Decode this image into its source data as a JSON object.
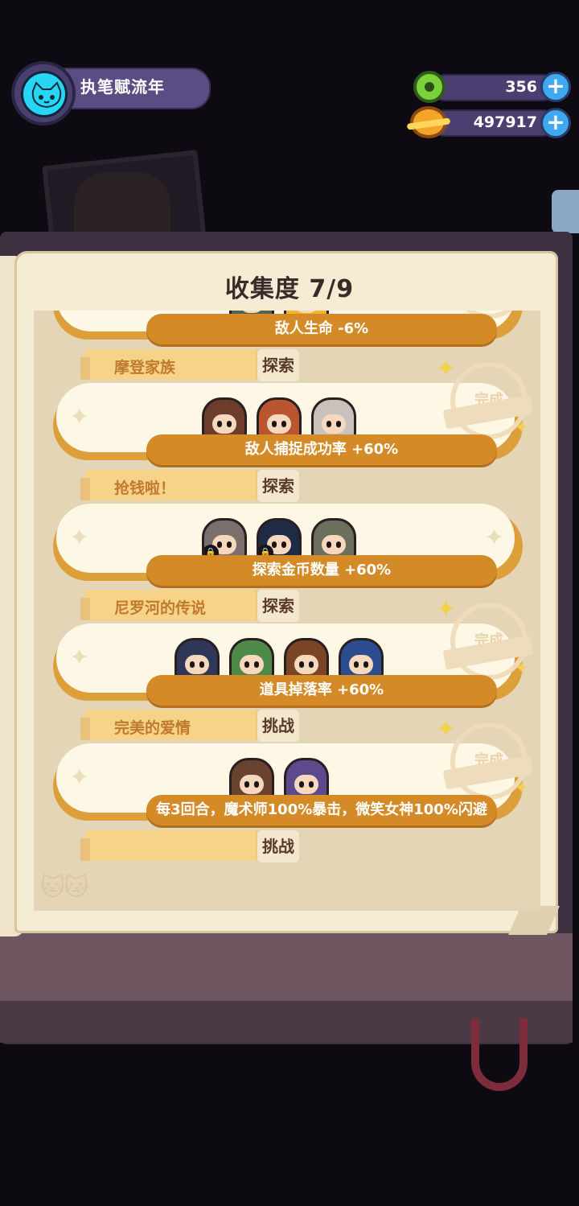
{
  "player": {
    "name": "执笔赋流年"
  },
  "currencies": [
    {
      "name": "gem",
      "value": "356",
      "icon": "green-donut-icon",
      "color": "#7bd13c"
    },
    {
      "name": "coin",
      "value": "497917",
      "icon": "gold-planet-icon",
      "color": "#f3a52a"
    }
  ],
  "collection": {
    "title": "收集度 7/9",
    "entries": [
      {
        "tag": "",
        "mode": "",
        "bonus": "敌人生命 -6%",
        "completed": true,
        "characters": [
          {
            "color": "#55624c",
            "locked": false
          },
          {
            "color": "#f0b52b",
            "locked": false
          }
        ]
      },
      {
        "tag": "摩登家族",
        "mode": "探索",
        "bonus": "敌人捕捉成功率 +60%",
        "completed": true,
        "characters": [
          {
            "color": "#6b3d2a",
            "locked": false
          },
          {
            "color": "#b9552f",
            "locked": false
          },
          {
            "color": "#c9c2bc",
            "locked": false
          }
        ]
      },
      {
        "tag": "抢钱啦！",
        "mode": "探索",
        "bonus": "探索金币数量 +60%",
        "completed": false,
        "characters": [
          {
            "color": "#7b6f6d",
            "locked": true
          },
          {
            "color": "#1f2a44",
            "locked": true
          },
          {
            "color": "#6a6f5e",
            "locked": false
          }
        ]
      },
      {
        "tag": "尼罗河的传说",
        "mode": "探索",
        "bonus": "道具掉落率 +60%",
        "completed": true,
        "characters": [
          {
            "color": "#2e3758",
            "locked": false
          },
          {
            "color": "#4e8a47",
            "locked": false
          },
          {
            "color": "#7a4426",
            "locked": false
          },
          {
            "color": "#2b4c8e",
            "locked": false
          }
        ]
      },
      {
        "tag": "完美的爱情",
        "mode": "挑战",
        "bonus": "每3回合，魔术师100%暴击，微笑女神100%闪避",
        "completed": true,
        "characters": [
          {
            "color": "#6a4330",
            "locked": false
          },
          {
            "color": "#5d4a8c",
            "locked": false
          }
        ]
      },
      {
        "tag": "",
        "mode": "挑战",
        "bonus": "",
        "completed": false,
        "characters": []
      }
    ],
    "stamp_text": "完成"
  }
}
